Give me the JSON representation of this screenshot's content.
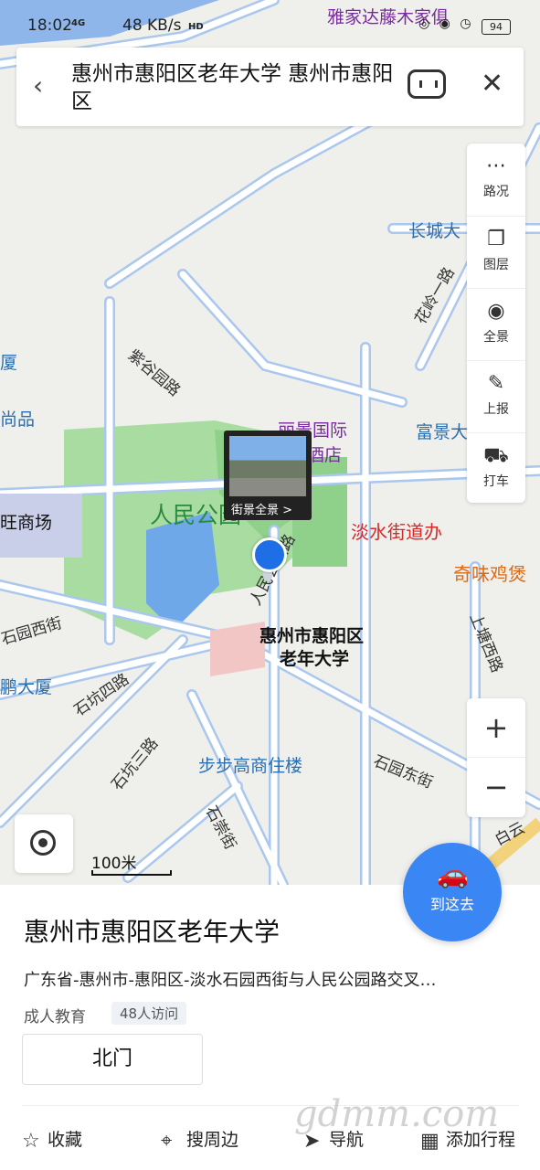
{
  "status": {
    "time": "18:02",
    "network": "4G",
    "speed": "48 KB/s",
    "hd": "HD",
    "icons": "◎ ◉ ◷",
    "battery": "94"
  },
  "search": {
    "query": "惠州市惠阳区老年大学 惠州市惠阳区"
  },
  "tools": [
    {
      "label": "路况",
      "icon": "traffic-icon"
    },
    {
      "label": "图层",
      "icon": "layers-icon"
    },
    {
      "label": "全景",
      "icon": "panorama-icon"
    },
    {
      "label": "上报",
      "icon": "report-icon"
    },
    {
      "label": "打车",
      "icon": "taxi-icon"
    }
  ],
  "map": {
    "labels": {
      "top_poi": "雅家达藤木家俱",
      "changcheng": "长城大",
      "liangjing_1": "丽景国际",
      "liangjing_2": "酒店",
      "fujing": "富景大",
      "danshui": "淡水街道办",
      "qiwei": "奇味鸡煲",
      "renmin": "人民公园",
      "target_1": "惠州市惠阳区",
      "target_2": "老年大学",
      "bubugao": "步步高商住楼",
      "shiyuan_west": "石园西街",
      "shikeng_road": "石坑四路",
      "shikeng3": "石坑三路",
      "shiyuan_east": "石园东街",
      "shangtang": "上塘西路",
      "baiyun": "白云",
      "xa": "厦",
      "shangpin": "尚品",
      "shangchang": "旺商场",
      "pengdasha": "鹏大厦",
      "road_left": "紫谷园路",
      "road_right": "花岭一路",
      "renmin_road": "人民公园路",
      "shichong": "石崇街"
    },
    "streetview": "街景全景 >",
    "scale": "100米"
  },
  "go": {
    "label": "到这去"
  },
  "place": {
    "title": "惠州市惠阳区老年大学",
    "address": "广东省-惠州市-惠阳区-淡水石园西街与人民公园路交叉…",
    "category": "成人教育",
    "visits": "48人访问",
    "gate": "北门"
  },
  "actions": [
    {
      "label": "收藏",
      "icon": "star-icon"
    },
    {
      "label": "搜周边",
      "icon": "nearby-icon"
    },
    {
      "label": "导航",
      "icon": "navigate-icon"
    },
    {
      "label": "添加行程",
      "icon": "calendar-icon"
    }
  ],
  "watermark": "gdmm.com"
}
